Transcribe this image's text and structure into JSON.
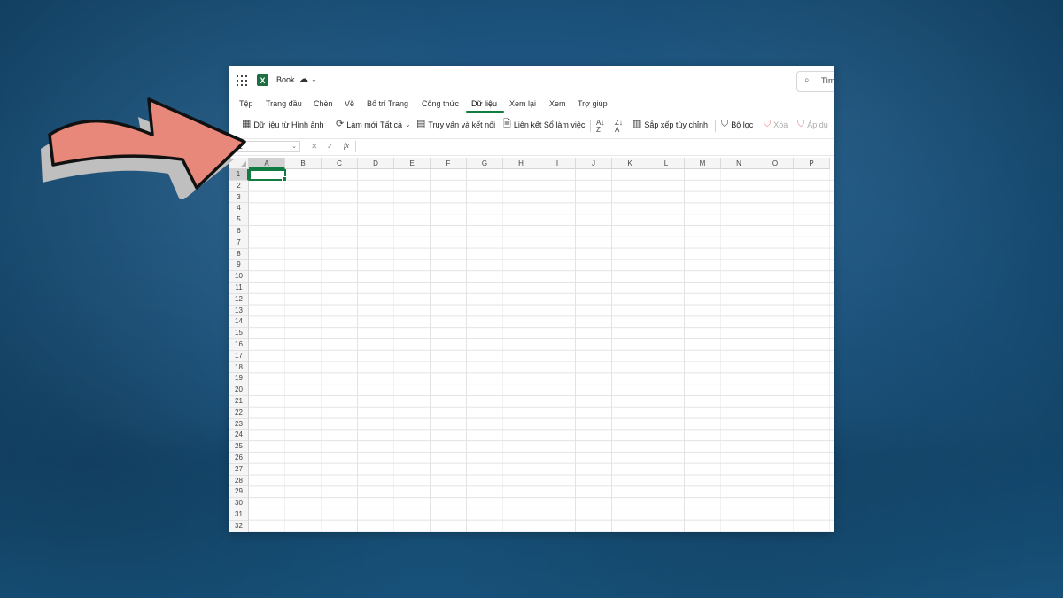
{
  "app": {
    "file_name": "Book",
    "search_placeholder": "Tìm"
  },
  "tabs": [
    {
      "label": "Tệp"
    },
    {
      "label": "Trang đầu"
    },
    {
      "label": "Chèn"
    },
    {
      "label": "Vẽ"
    },
    {
      "label": "Bố trí Trang"
    },
    {
      "label": "Công thức"
    },
    {
      "label": "Dữ liệu",
      "active": true
    },
    {
      "label": "Xem lại"
    },
    {
      "label": "Xem"
    },
    {
      "label": "Trợ giúp"
    }
  ],
  "toolbar": {
    "data_from_picture": "Dữ liệu từ Hình ảnh",
    "refresh_all": "Làm mới Tất cả",
    "queries_connections": "Truy vấn và kết nối",
    "workbook_links": "Liên kết Sổ làm việc",
    "custom_sort": "Sắp xếp tùy chỉnh",
    "filter": "Bộ lọc",
    "clear": "Xóa",
    "reapply": "Áp dụ"
  },
  "formula_bar": {
    "name_box": "A1",
    "fx": "fx",
    "value": ""
  },
  "grid": {
    "columns": [
      "A",
      "B",
      "C",
      "D",
      "E",
      "F",
      "G",
      "H",
      "I",
      "J",
      "K",
      "L",
      "M",
      "N",
      "O",
      "P"
    ],
    "rows": [
      "1",
      "2",
      "3",
      "4",
      "5",
      "6",
      "7",
      "8",
      "9",
      "10",
      "11",
      "12",
      "13",
      "14",
      "15",
      "16",
      "17",
      "18",
      "19",
      "20",
      "21",
      "22",
      "23",
      "24",
      "25",
      "26",
      "27",
      "28",
      "29",
      "30",
      "31",
      "32"
    ],
    "selected_cell": "A1"
  },
  "colors": {
    "accent": "#107c41",
    "arrow_fill": "#e8887a",
    "background": "#1d5580"
  }
}
